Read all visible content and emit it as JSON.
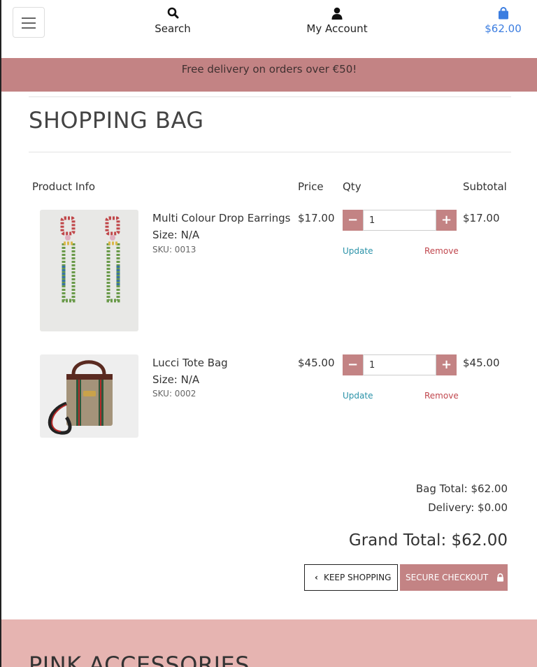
{
  "header": {
    "search_label": "Search",
    "account_label": "My Account",
    "bag_total": "$62.00",
    "icons": {
      "menu": "hamburger-icon",
      "search": "search-icon",
      "account": "user-icon",
      "bag": "shopping-bag-icon"
    }
  },
  "banner": {
    "text": "Free delivery on orders over €50!"
  },
  "page": {
    "title": "SHOPPING BAG"
  },
  "table": {
    "headers": {
      "product": "Product Info",
      "price": "Price",
      "qty": "Qty",
      "subtotal": "Subtotal"
    },
    "items": [
      {
        "name": "Multi Colour Drop Earrings",
        "size": "Size: N/A",
        "sku": "SKU: 0013",
        "price": "$17.00",
        "qty": "1",
        "subtotal": "$17.00",
        "update": "Update",
        "remove": "Remove"
      },
      {
        "name": "Lucci Tote Bag",
        "size": "Size: N/A",
        "sku": "SKU: 0002",
        "price": "$45.00",
        "qty": "1",
        "subtotal": "$45.00",
        "update": "Update",
        "remove": "Remove"
      }
    ]
  },
  "totals": {
    "bag": "Bag Total: $62.00",
    "delivery": "Delivery: $0.00",
    "grand": "Grand Total: $62.00"
  },
  "actions": {
    "keep_shopping": "KEEP SHOPPING",
    "checkout": "SECURE CHECKOUT"
  },
  "footer": {
    "title": "PINK ACCESSORIES"
  },
  "colors": {
    "brand_pink": "#c38384",
    "footer_pink": "#e6b4b1",
    "link_blue": "#3b7de0",
    "update_teal": "#2a92a8",
    "remove_red": "#c0464d"
  }
}
